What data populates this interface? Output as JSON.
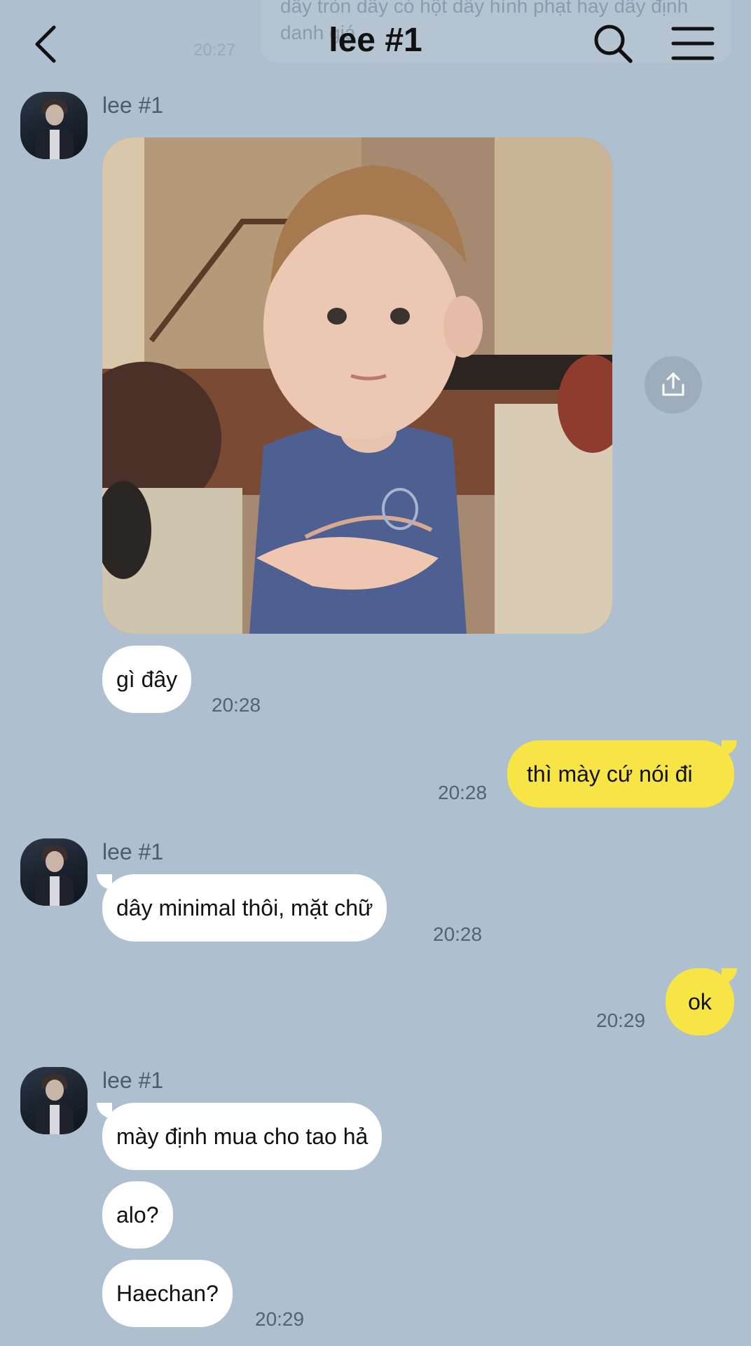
{
  "ghost": {
    "text": "dây tròn dây có hột dây hình phạt hay dây định danh giá",
    "time": "20:27"
  },
  "header": {
    "title": "lee #1",
    "back_icon": "chevron-left-icon",
    "search_icon": "search-icon",
    "menu_icon": "hamburger-menu-icon"
  },
  "colors": {
    "background": "#aebfcf",
    "incoming_bubble": "#ffffff",
    "outgoing_bubble": "#f7e445"
  },
  "messages": {
    "m1": {
      "sender": "lee #1",
      "text": "gì đây",
      "time": "20:28"
    },
    "m2": {
      "text": "thì mày cứ nói đi",
      "time": "20:28"
    },
    "m3": {
      "sender": "lee #1",
      "text": "dây minimal thôi, mặt chữ",
      "time": "20:28"
    },
    "m4": {
      "text": "ok",
      "time": "20:29"
    },
    "m5": {
      "sender": "lee #1",
      "text": "mày định mua cho tao hả"
    },
    "m6": {
      "text": "alo?"
    },
    "m7": {
      "text": "Haechan?",
      "time": "20:29"
    }
  }
}
